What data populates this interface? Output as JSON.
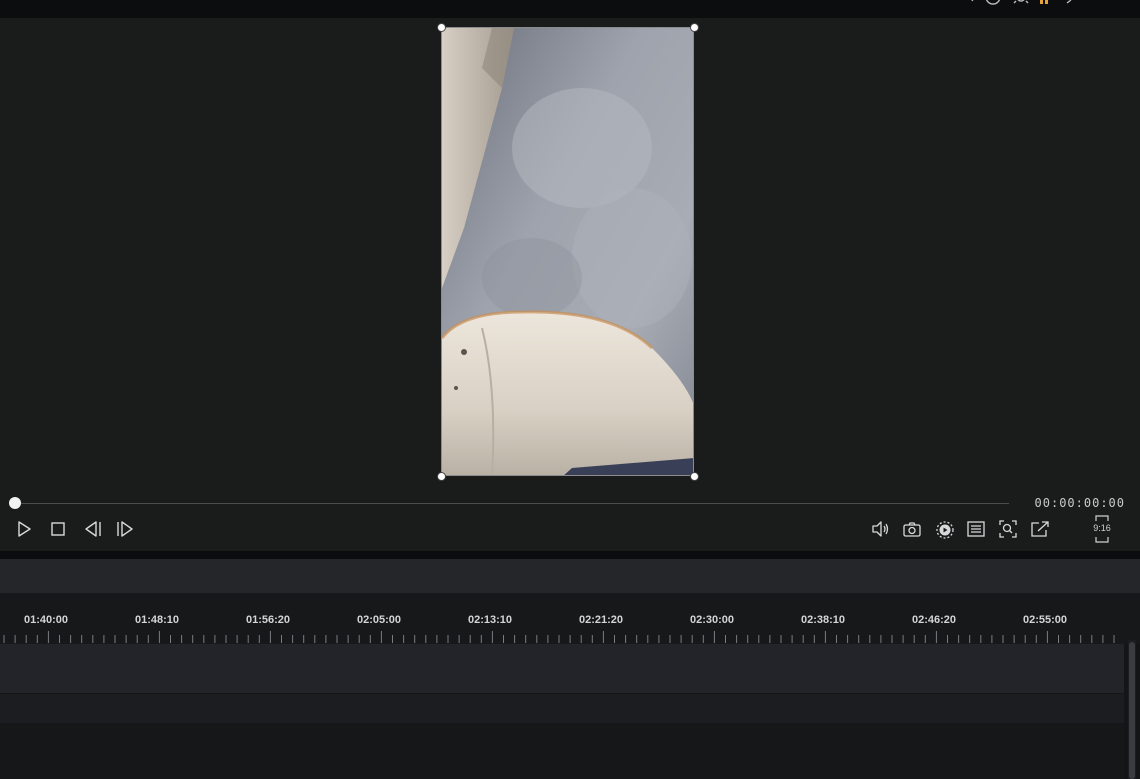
{
  "window": {
    "top_icons": [
      "undo-icon",
      "help-icon",
      "settings-icon",
      "brand-icon",
      "minimize-icon"
    ]
  },
  "player": {
    "timecode": "00:00:00:00",
    "progress": 0,
    "aspect_ratio": "9:16",
    "controls_left": [
      "play-icon",
      "stop-icon",
      "previous-frame-icon",
      "next-frame-icon"
    ],
    "controls_right": [
      "volume-icon",
      "snapshot-icon",
      "playback-speed-icon",
      "subtitles-icon",
      "zoom-fit-icon",
      "popout-icon"
    ]
  },
  "timeline": {
    "ruler_labels": [
      "01:40:00",
      "01:48:10",
      "01:56:20",
      "02:05:00",
      "02:13:10",
      "02:21:20",
      "02:30:00",
      "02:38:10",
      "02:46:20",
      "02:55:00"
    ]
  },
  "colors": {
    "background": "#141516",
    "preview_bg": "#1a1c1c",
    "ruler_text": "#d4d5d7",
    "accent": "#e8a33a"
  }
}
